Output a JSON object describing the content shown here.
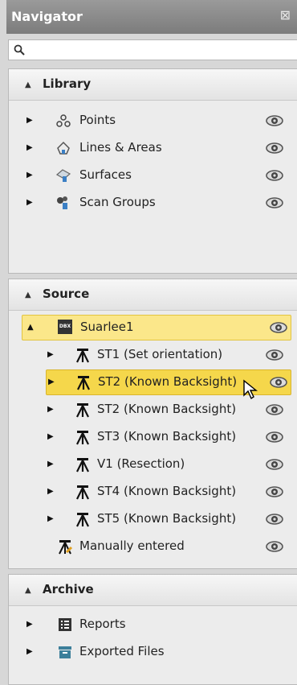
{
  "window": {
    "title": "Navigator",
    "close_glyph": "⊠"
  },
  "search": {
    "placeholder": ""
  },
  "library": {
    "title": "Library",
    "items": [
      {
        "label": "Points",
        "icon": "points-icon"
      },
      {
        "label": "Lines & Areas",
        "icon": "lines-areas-icon"
      },
      {
        "label": "Surfaces",
        "icon": "surfaces-icon"
      },
      {
        "label": "Scan Groups",
        "icon": "scan-groups-icon"
      }
    ]
  },
  "source": {
    "title": "Source",
    "root": {
      "label": "Suarlee1",
      "icon_text": "DBX"
    },
    "items": [
      {
        "label": "ST1 (Set orientation)"
      },
      {
        "label": "ST2 (Known Backsight)"
      },
      {
        "label": "ST2 (Known Backsight)"
      },
      {
        "label": "ST3 (Known Backsight)"
      },
      {
        "label": "V1 (Resection)"
      },
      {
        "label": "ST4 (Known Backsight)"
      },
      {
        "label": "ST5 (Known Backsight)"
      }
    ],
    "manual": {
      "label": "Manually entered"
    }
  },
  "archive": {
    "title": "Archive",
    "items": [
      {
        "label": "Reports",
        "icon": "reports-icon"
      },
      {
        "label": "Exported Files",
        "icon": "exported-files-icon"
      }
    ]
  },
  "colors": {
    "highlight": "#fbe78a",
    "highlight_strong": "#f5d74b",
    "titlebar": "#8a8a8a"
  }
}
